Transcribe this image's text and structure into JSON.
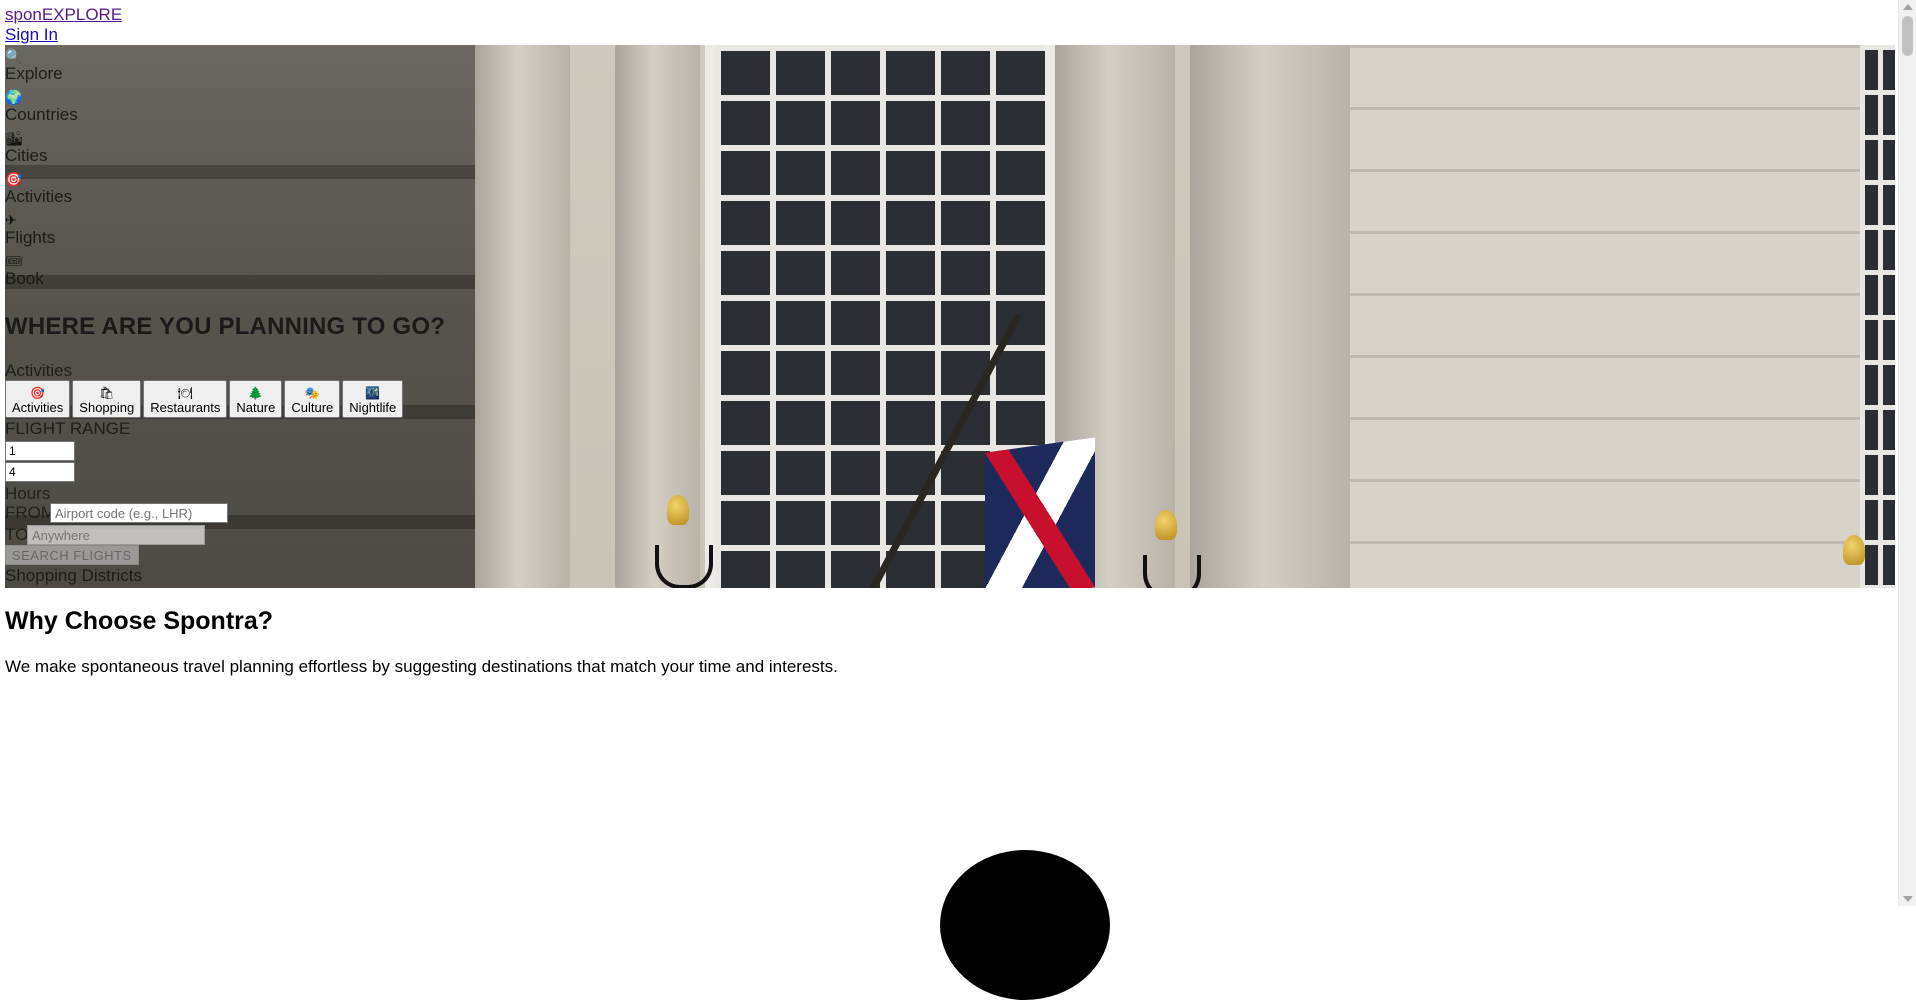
{
  "header": {
    "logo_text": "sponEXPLORE",
    "signin_label": "Sign In"
  },
  "nav": {
    "items": [
      {
        "icon": "search-icon",
        "glyph": "🔍",
        "label": "Explore"
      },
      {
        "icon": "globe-icon",
        "glyph": "🌍",
        "label": "Countries"
      },
      {
        "icon": "city-icon",
        "glyph": "🏙",
        "label": "Cities"
      },
      {
        "icon": "target-icon",
        "glyph": "🎯",
        "label": "Activities"
      },
      {
        "icon": "airplane-icon",
        "glyph": "✈",
        "label": "Flights"
      },
      {
        "icon": "ticket-icon",
        "glyph": "🎟",
        "label": "Book"
      }
    ]
  },
  "hero": {
    "title": "WHERE ARE YOU PLANNING TO GO?",
    "selected_label": "Activities",
    "categories": [
      {
        "icon": "target-icon",
        "glyph": "🎯",
        "label": "Activities"
      },
      {
        "icon": "shopping-icon",
        "glyph": "🛍",
        "label": "Shopping"
      },
      {
        "icon": "plate-icon",
        "glyph": "🍽",
        "label": "Restaurants"
      },
      {
        "icon": "tree-icon",
        "glyph": "🌲",
        "label": "Nature"
      },
      {
        "icon": "culture-icon",
        "glyph": "🎭",
        "label": "Culture"
      },
      {
        "icon": "nightlife-icon",
        "glyph": "🌃",
        "label": "Nightlife"
      }
    ],
    "flight_range_label": "FLIGHT RANGE",
    "range_min": "1",
    "range_max": "4",
    "hours_label": "Hours",
    "from_label": "FROM",
    "from_placeholder": "Airport code (e.g., LHR)",
    "to_label": "TO",
    "to_placeholder": "Anywhere",
    "search_label": "SEARCH FLIGHTS",
    "result_label": "Shopping Districts"
  },
  "why": {
    "title": "Why Choose Spontra?",
    "text": "We make spontaneous travel planning effortless by suggesting destinations that match your time and interests."
  }
}
